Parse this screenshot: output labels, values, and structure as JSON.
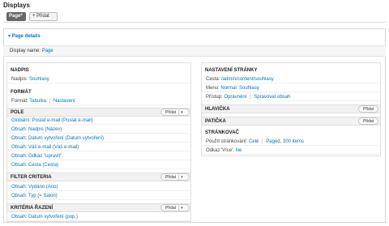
{
  "header": {
    "title": "Displays"
  },
  "tabs": {
    "page_label": "Page*",
    "add_label": "+ Přidat"
  },
  "page_details": {
    "toggle_label": "▾ Page details"
  },
  "display_name": {
    "label": "Display name:",
    "value": "Page"
  },
  "left": {
    "nadpis": {
      "title": "NADPIS",
      "row_label": "Nadpis:",
      "row_value": "Souhlasy"
    },
    "format": {
      "title": "FORMÁT",
      "row_label": "Formát:",
      "value": "Tabulka",
      "settings": "Nastavení"
    },
    "pole": {
      "title": "POLE",
      "add": "Přidat",
      "items": [
        "Globální: Poslat e-mail (Poslat e-mail)",
        "Obsah: Nadpis (Název)",
        "Obsah: Datum vytvoření (Datum vytvoření)",
        "Obsah: Váš e-mail (Váš e-mail)",
        "Obsah: Odkaz \"upravit\"",
        "Obsah: Cesta (Cesta)"
      ]
    },
    "filter": {
      "title": "FILTER CRITERIA",
      "add": "Přidat",
      "items": [
        "Obsah: Vydáno (Ano)",
        "Obsah: Typ (= Salon)"
      ]
    },
    "sort": {
      "title": "KRITÉRIA ŘAZENÍ",
      "add": "Přidat",
      "items": [
        "Obsah: Datum vytvoření (pop.)"
      ]
    }
  },
  "right": {
    "page_settings": {
      "title": "NASTAVENÍ STRÁNKY",
      "path_label": "Cesta:",
      "path_value": "/admin/content/souhlasy",
      "menu_label": "Menu:",
      "menu_value": "Normal: Souhlasy",
      "access_label": "Přístup:",
      "access_value": "Oprávnění",
      "access_manage": "Spravovat obsah"
    },
    "header_section": {
      "title": "HLAVIČKA",
      "add": "Přidat"
    },
    "footer_section": {
      "title": "PATIČKA",
      "add": "Přidat"
    },
    "pager": {
      "title": "STRÁNKOVAČ",
      "use_label": "Použít stránkování:",
      "use_value": "Celé",
      "paged": "Paged, 300 items",
      "more_label": "Odkaz 'Více':",
      "more_value": "Ne"
    }
  }
}
